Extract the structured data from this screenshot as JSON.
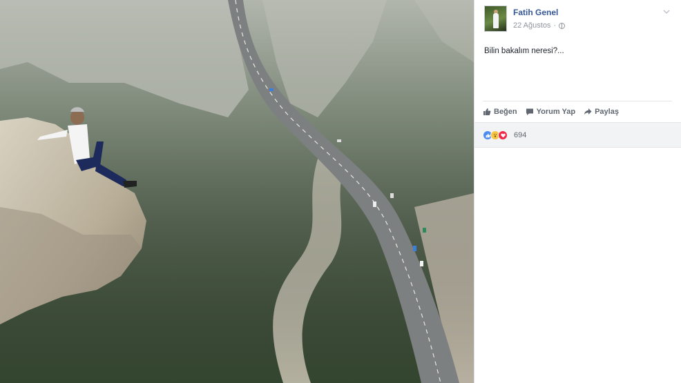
{
  "photo": {
    "alt_semantic": "cliff-highway-photo"
  },
  "post": {
    "author": "Fatih Genel",
    "date": "22 Ağustos",
    "text": "Bilin bakalım neresi?..."
  },
  "actions": {
    "like_label": "Beğen",
    "comment_label": "Yorum Yap",
    "share_label": "Paylaş"
  },
  "reactions": {
    "count": "694",
    "icons": [
      "like-icon",
      "wow-icon",
      "love-icon"
    ]
  },
  "colors": {
    "author_link": "#365899",
    "meta_gray": "#90949c",
    "action_gray": "#606770",
    "reaction_bar_bg": "#f2f3f5",
    "like_blue": "#4a8cf0",
    "wow_yellow": "#f6c644",
    "love_red": "#f0284a"
  }
}
